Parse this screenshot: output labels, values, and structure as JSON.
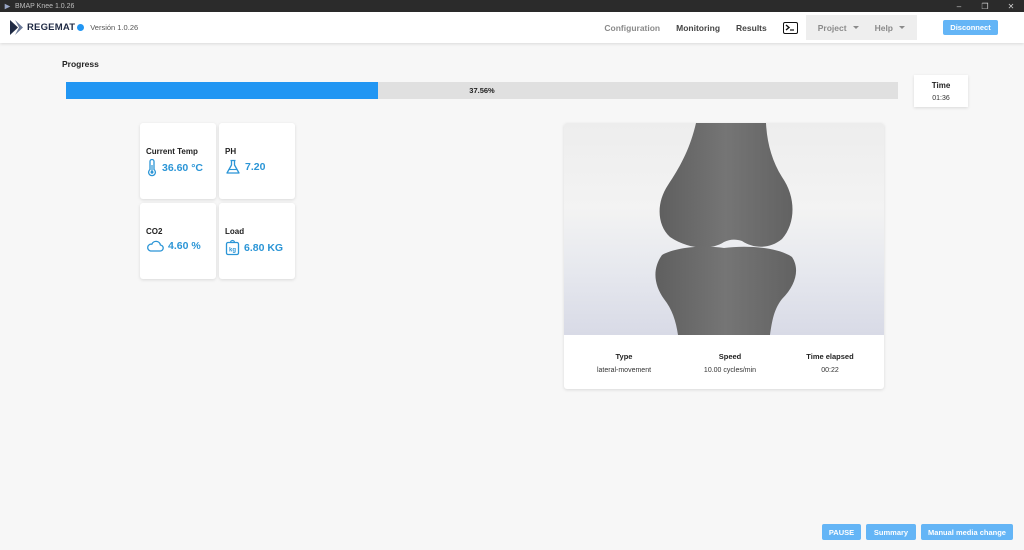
{
  "window": {
    "title": "BMAP Knee 1.0.26",
    "controls": [
      "–",
      "❐",
      "✕"
    ]
  },
  "navbar": {
    "brand": "REGEMAT",
    "version": "Versión 1.0.26",
    "links": {
      "configuration": "Configuration",
      "monitoring": "Monitoring",
      "results": "Results"
    },
    "dropdowns": {
      "project": "Project",
      "help": "Help"
    },
    "disconnect": "Disconnect"
  },
  "progress": {
    "title": "Progress",
    "percent": 37.56,
    "label": "37.56%"
  },
  "time": {
    "label": "Time",
    "value": "01:36"
  },
  "sensors": [
    {
      "label": "Current Temp",
      "value": "36.60 °C",
      "icon": "thermometer-icon"
    },
    {
      "label": "PH",
      "value": "7.20",
      "icon": "flask-icon"
    },
    {
      "label": "CO2",
      "value": "4.60 %",
      "icon": "cloud-icon"
    },
    {
      "label": "Load",
      "value": "6.80 KG",
      "icon": "weight-kg-icon"
    }
  ],
  "movement": {
    "type_label": "Type",
    "type_value": "lateral-movement",
    "speed_label": "Speed",
    "speed_value": "10.00 cycles/min",
    "elapsed_label": "Time elapsed",
    "elapsed_value": "00:22"
  },
  "buttons": {
    "pause": "PAUSE",
    "summary": "Summary",
    "media_change": "Manual media change"
  },
  "colors": {
    "accent": "#2196f3",
    "value_text": "#2b95d6",
    "button": "#64b5f6",
    "knee_model": "#6e6e6e"
  }
}
